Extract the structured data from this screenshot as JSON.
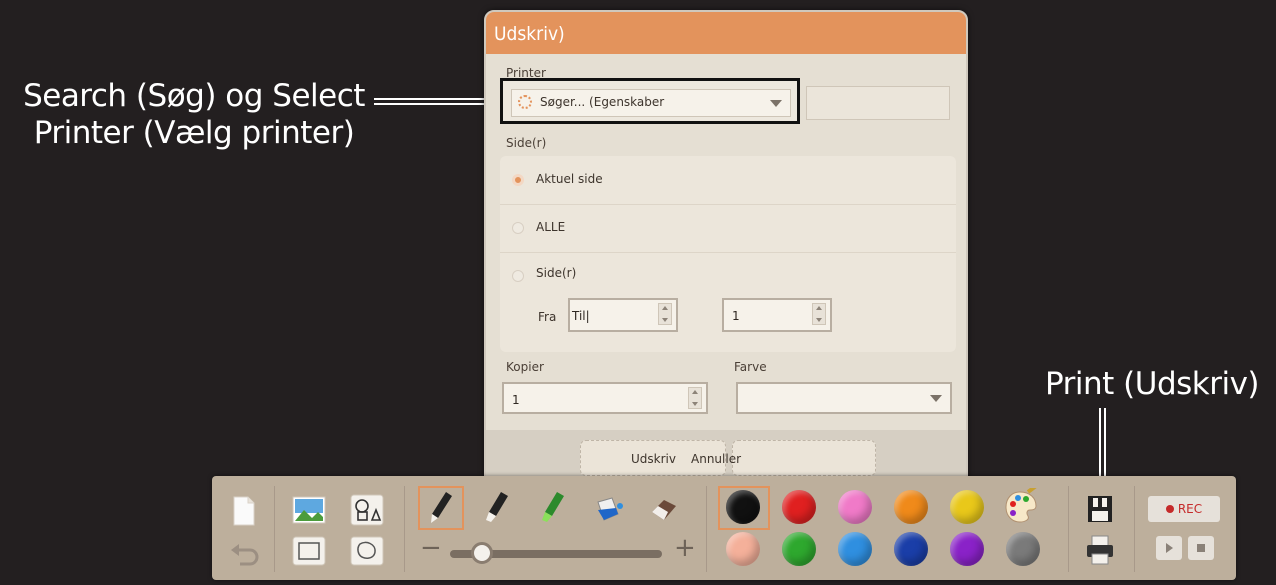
{
  "callouts": {
    "left_line1": "Search (Søg) og Select",
    "left_line2": "Printer (Vælg printer)",
    "right": "Print (Udskriv)"
  },
  "dialog": {
    "title": "Udskriv)",
    "printer_label": "Printer",
    "printer_select_value": "Søger...   (Egenskaber",
    "pages_label": "Side(r)",
    "page_options": [
      {
        "label": "Aktuel side",
        "selected": true
      },
      {
        "label": "ALLE",
        "selected": false
      },
      {
        "label": "Side(r)",
        "selected": false
      }
    ],
    "range": {
      "from_label": "Fra",
      "from_value": "Til|",
      "to_value": "1"
    },
    "copies_label": "Kopier",
    "copies_value": "1",
    "color_label": "Farve",
    "color_value": "",
    "print_button": "Udskriv",
    "cancel_button": "Annuller"
  },
  "toolbar": {
    "rec_label": "REC",
    "zoom_minus": "−",
    "zoom_plus": "+",
    "slider_value_fraction": 0.15,
    "colors_row1": [
      "#111111",
      "#e02020",
      "#f07ac8",
      "#f08a1a",
      "#e9c81a",
      "palette"
    ],
    "colors_row2": [
      "#f4b09a",
      "#2ea82e",
      "#2f8fe0",
      "#1a3ea8",
      "#8a22c8",
      "#7a7a7a"
    ],
    "accent": "#e3935c"
  },
  "icons": [
    "new-page-icon",
    "undo-icon",
    "image-icon",
    "shapes-icon",
    "rectangle-icon",
    "lasso-icon",
    "pen-icon",
    "marker-icon",
    "highlighter-icon",
    "fill-icon",
    "eraser-icon",
    "palette-icon",
    "save-icon",
    "print-icon",
    "play-icon",
    "stop-icon"
  ]
}
